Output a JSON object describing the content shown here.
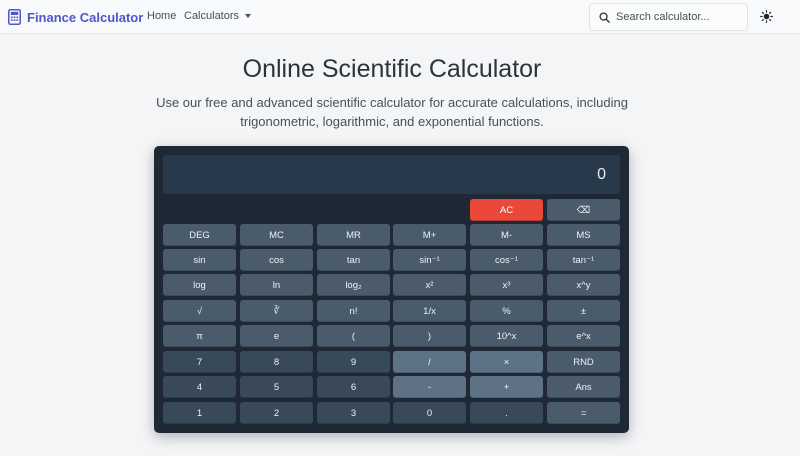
{
  "navbar": {
    "brand": "Finance Calculator",
    "links": {
      "home": "Home",
      "calculators": "Calculators"
    },
    "search": {
      "placeholder": "Search calculator...",
      "value": ""
    },
    "icons": {
      "brand": "calculator-icon",
      "search": "search-icon",
      "theme": "sun-icon"
    }
  },
  "page": {
    "title": "Online Scientific Calculator",
    "subtitle": "Use our free and advanced scientific calculator for accurate calculations, including trigonometric, logarithmic, and exponential functions."
  },
  "calculator": {
    "display": "0",
    "top_row": [
      "AC",
      "⌫"
    ],
    "rows": [
      [
        "DEG",
        "MC",
        "MR",
        "M+",
        "M-",
        "MS"
      ],
      [
        "sin",
        "cos",
        "tan",
        "sin⁻¹",
        "cos⁻¹",
        "tan⁻¹"
      ],
      [
        "log",
        "ln",
        "log₂",
        "x²",
        "x³",
        "x^y"
      ],
      [
        "√",
        "∛",
        "n!",
        "1/x",
        "%",
        "±"
      ],
      [
        "π",
        "e",
        "(",
        ")",
        "10^x",
        "e^x"
      ],
      [
        "7",
        "8",
        "9",
        "/",
        "×",
        "RND"
      ],
      [
        "4",
        "5",
        "6",
        "-",
        "+",
        "Ans"
      ],
      [
        "1",
        "2",
        "3",
        "0",
        ".",
        "="
      ]
    ]
  },
  "colors": {
    "brand": "#4f57c7",
    "calculator_bg": "#1e2935",
    "display_bg": "#27394a",
    "function_button": "#4a5c6b",
    "number_button": "#38495a",
    "operator_button": "#5d7284",
    "clear_button": "#e9483b"
  }
}
